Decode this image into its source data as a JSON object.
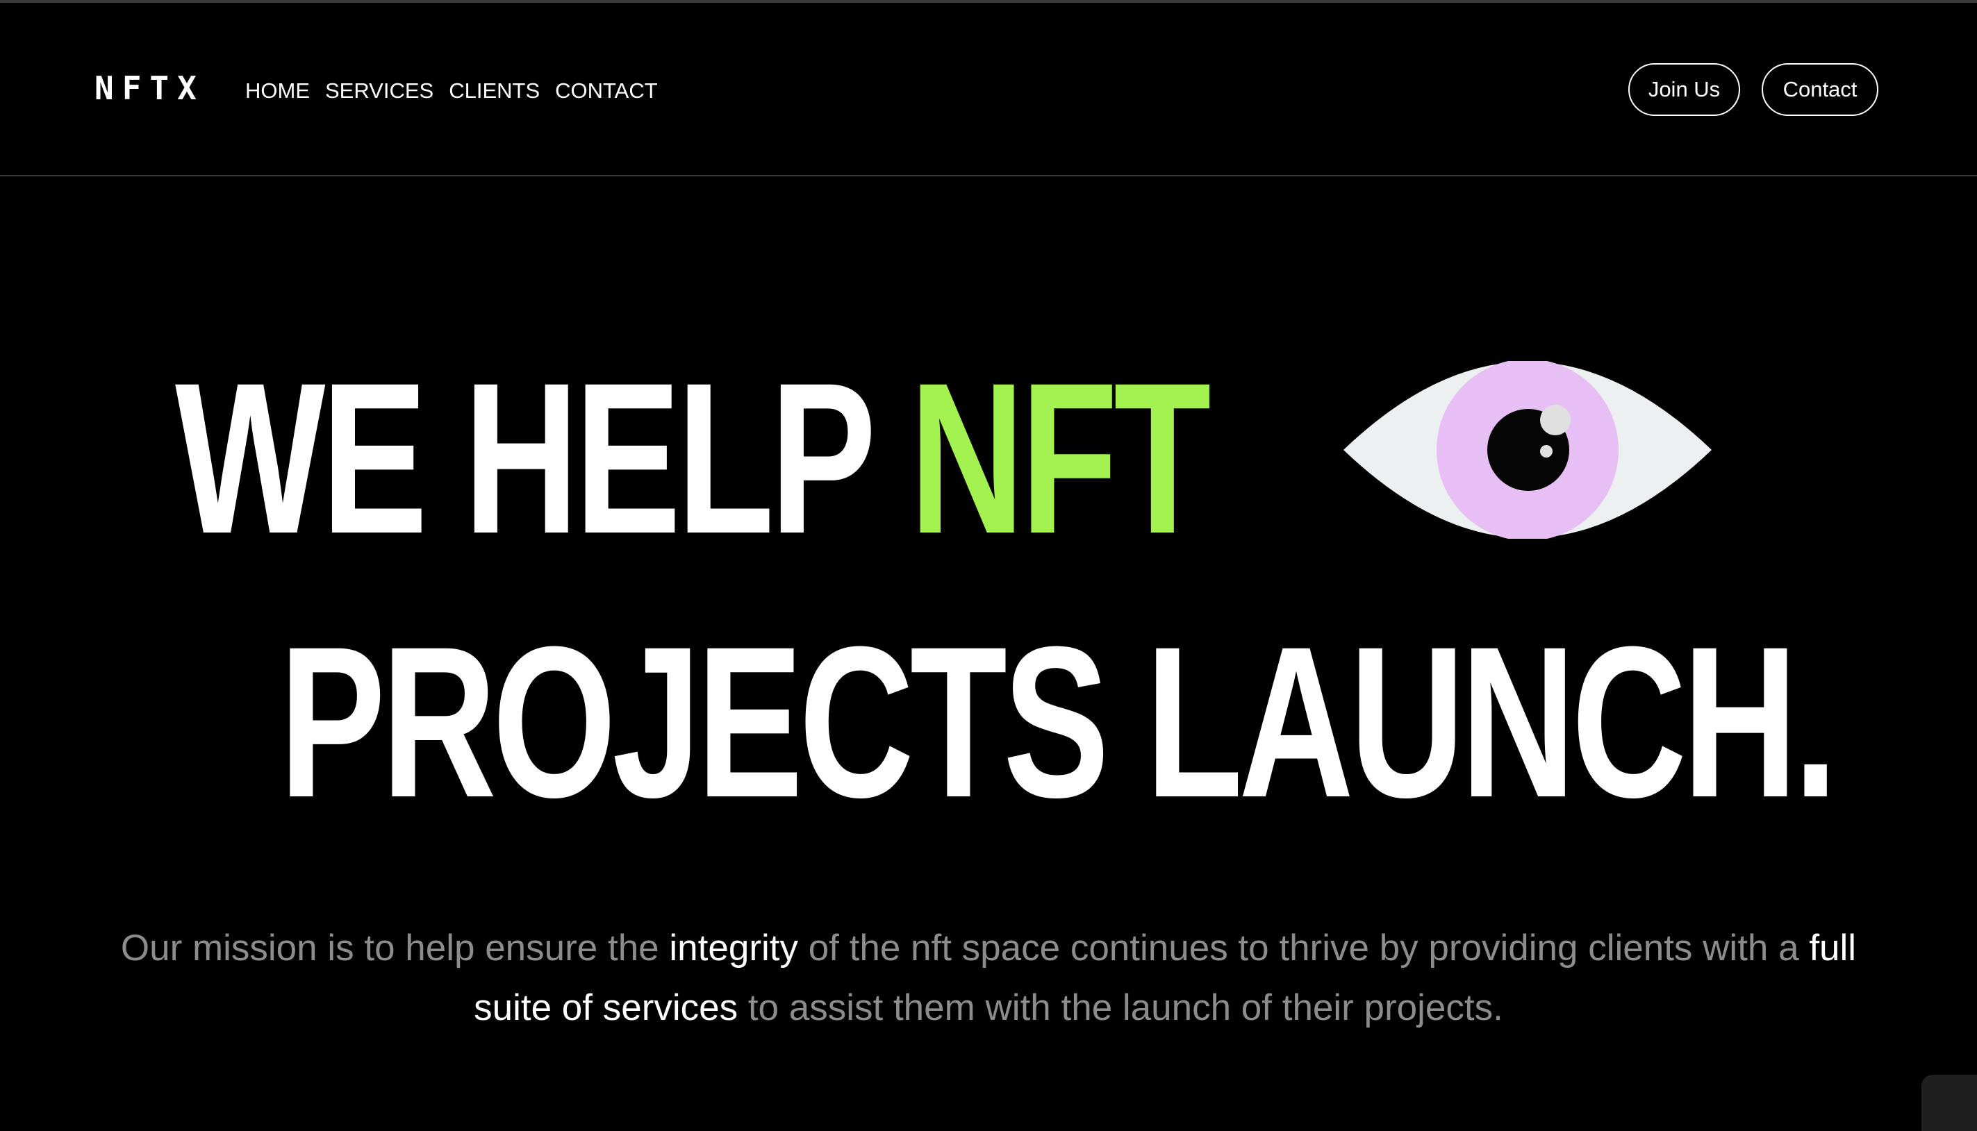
{
  "header": {
    "logo": "NFTX",
    "nav": [
      "HOME",
      "SERVICES",
      "CLIENTS",
      "CONTACT"
    ],
    "join_label": "Join Us",
    "contact_label": "Contact"
  },
  "hero": {
    "line1_prefix": "WE HELP ",
    "line1_accent": "NFT",
    "line2": "PROJECTS LAUNCH.",
    "mission": {
      "part1": "Our mission is to help ensure the ",
      "highlight1": "integrity",
      "part2": " of the nft space continues to thrive by providing clients with a ",
      "highlight2": "full suite of services",
      "part3": " to assist them with the launch of their projects."
    },
    "eye_icon": "eye-illustration"
  },
  "colors": {
    "background": "#000000",
    "accent": "#a3f24f",
    "iris": "#e8bff5",
    "sclera": "#edf0f0",
    "muted_text": "#8c8c8c"
  }
}
